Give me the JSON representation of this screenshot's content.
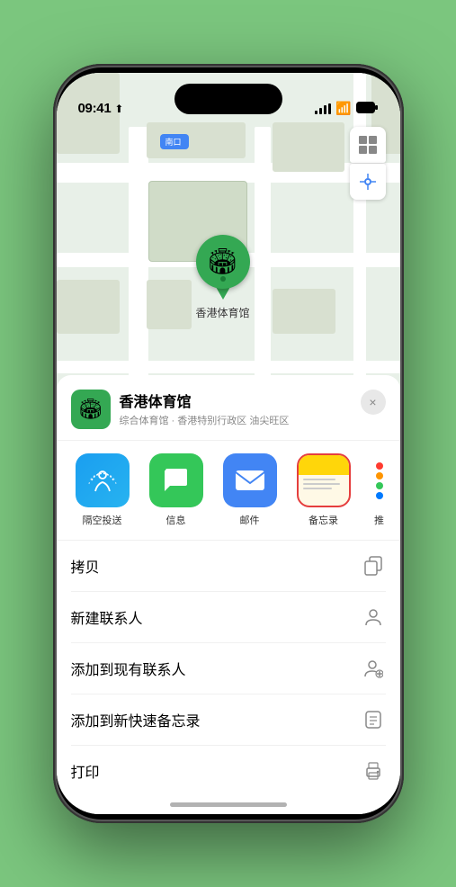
{
  "status_bar": {
    "time": "09:41",
    "location_arrow": "▲"
  },
  "venue": {
    "name": "香港体育馆",
    "category": "综合体育馆 · 香港特别行政区 油尖旺区",
    "pin_label": "香港体育馆",
    "icon": "🏟"
  },
  "map": {
    "label": "南口"
  },
  "share_items": [
    {
      "id": "airdrop",
      "label": "隔空投送",
      "type": "airdrop"
    },
    {
      "id": "messages",
      "label": "信息",
      "type": "messages"
    },
    {
      "id": "mail",
      "label": "邮件",
      "type": "mail"
    },
    {
      "id": "notes",
      "label": "备忘录",
      "type": "notes"
    },
    {
      "id": "more",
      "label": "推",
      "type": "more"
    }
  ],
  "actions": [
    {
      "id": "copy",
      "label": "拷贝",
      "icon": "copy"
    },
    {
      "id": "new-contact",
      "label": "新建联系人",
      "icon": "person"
    },
    {
      "id": "add-to-contact",
      "label": "添加到现有联系人",
      "icon": "person-add"
    },
    {
      "id": "add-note",
      "label": "添加到新快速备忘录",
      "icon": "note"
    },
    {
      "id": "print",
      "label": "打印",
      "icon": "print"
    }
  ],
  "close_label": "×"
}
